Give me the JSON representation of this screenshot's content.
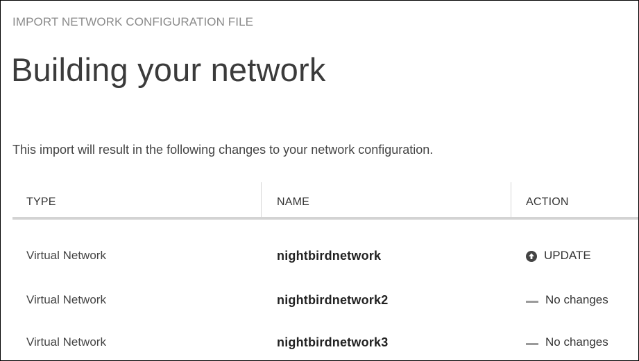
{
  "dialog": {
    "eyebrow": "IMPORT NETWORK CONFIGURATION FILE",
    "title": "Building your network",
    "description": "This import will result in the following changes to your network configuration."
  },
  "table": {
    "columns": {
      "type": "TYPE",
      "name": "NAME",
      "action": "ACTION"
    },
    "rows": [
      {
        "type": "Virtual Network",
        "name": "nightbirdnetwork",
        "action": "UPDATE",
        "action_icon": "update-arrow-up-icon"
      },
      {
        "type": "Virtual Network",
        "name": "nightbirdnetwork2",
        "action": "No changes",
        "action_icon": "dash-icon"
      },
      {
        "type": "Virtual Network",
        "name": "nightbirdnetwork3",
        "action": "No changes",
        "action_icon": "dash-icon"
      }
    ]
  },
  "colors": {
    "eyebrow": "#8a8a8a",
    "title": "#3b3b3b",
    "separator": "#d3d3d3",
    "update_icon": "#444444"
  }
}
